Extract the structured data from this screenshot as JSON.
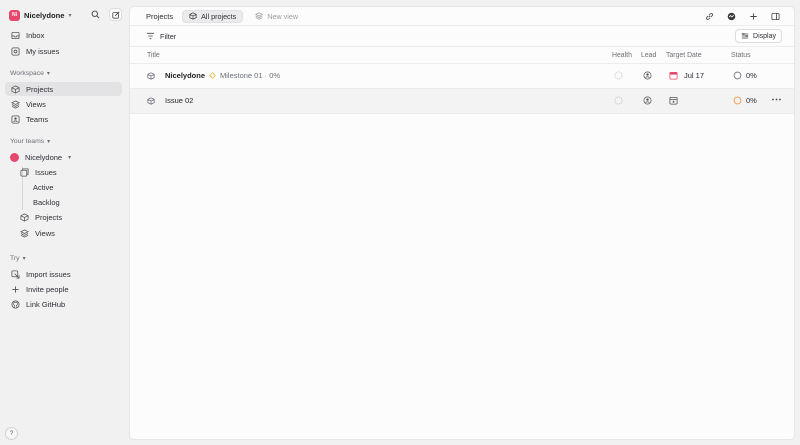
{
  "workspace": {
    "avatar_initials": "NI",
    "name": "Nicelydone",
    "brand_color": "#e5486b"
  },
  "sidebar": {
    "top_items": [
      {
        "label": "Inbox",
        "icon": "inbox-icon"
      },
      {
        "label": "My issues",
        "icon": "target-icon"
      }
    ],
    "workspace_label": "Workspace",
    "workspace_items": [
      {
        "label": "Projects",
        "icon": "cube-icon",
        "active": true
      },
      {
        "label": "Views",
        "icon": "layers-icon"
      },
      {
        "label": "Teams",
        "icon": "teams-icon"
      }
    ],
    "teams_label": "Your teams",
    "team": {
      "name": "Nicelydone"
    },
    "team_items": [
      {
        "label": "Issues",
        "icon": "issues-icon"
      },
      {
        "label": "Active"
      },
      {
        "label": "Backlog"
      },
      {
        "label": "Projects",
        "icon": "cube-icon"
      },
      {
        "label": "Views",
        "icon": "layers-icon"
      }
    ],
    "try_label": "Try",
    "try_items": [
      {
        "label": "Import issues",
        "icon": "import-icon"
      },
      {
        "label": "Invite people",
        "icon": "plus-icon"
      },
      {
        "label": "Link GitHub",
        "icon": "github-icon"
      }
    ],
    "help_label": "?"
  },
  "topbar": {
    "breadcrumb": "Projects",
    "tabs": [
      {
        "label": "All projects",
        "active": true
      },
      {
        "label": "New view",
        "active": false
      }
    ]
  },
  "filterbar": {
    "filter_label": "Filter",
    "display_label": "Display"
  },
  "table": {
    "columns": {
      "title": "Title",
      "health": "Health",
      "lead": "Lead",
      "target_date": "Target Date",
      "status": "Status"
    },
    "rows": [
      {
        "name": "Nicelydone",
        "milestone": "Milestone 01 · 0%",
        "target_date": "Jul 17",
        "status": "0%",
        "status_color": "#6b6f76"
      },
      {
        "name": "Issue 02",
        "milestone": "",
        "target_date": "",
        "status": "0%",
        "status_color": "#f2994a"
      }
    ]
  }
}
